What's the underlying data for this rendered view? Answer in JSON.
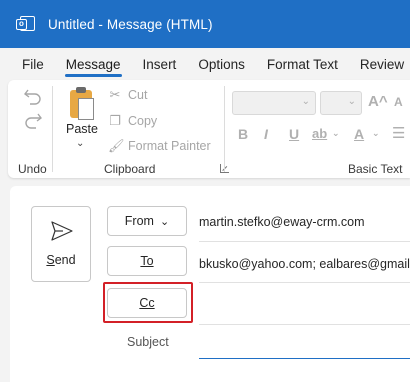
{
  "window": {
    "title": "Untitled  -  Message (HTML)",
    "accent": "#1f6fc5"
  },
  "tabs": [
    {
      "label": "File"
    },
    {
      "label": "Message",
      "active": true
    },
    {
      "label": "Insert"
    },
    {
      "label": "Options"
    },
    {
      "label": "Format Text"
    },
    {
      "label": "Review"
    }
  ],
  "ribbon": {
    "undo_group": {
      "label": "Undo"
    },
    "clipboard": {
      "label": "Clipboard",
      "paste": "Paste",
      "cut": "Cut",
      "copy": "Copy",
      "format_painter": "Format Painter"
    },
    "basic_text": {
      "label": "Basic Text"
    }
  },
  "compose": {
    "send": "Send",
    "from_button": "From",
    "from_value": "martin.stefko@eway-crm.com",
    "to_button": "To",
    "to_value": "bkusko@yahoo.com; ealbares@gmail.co",
    "cc_button": "Cc",
    "cc_value": "",
    "subject_label": "Subject",
    "subject_value": "",
    "highlight_color": "#d32027"
  }
}
